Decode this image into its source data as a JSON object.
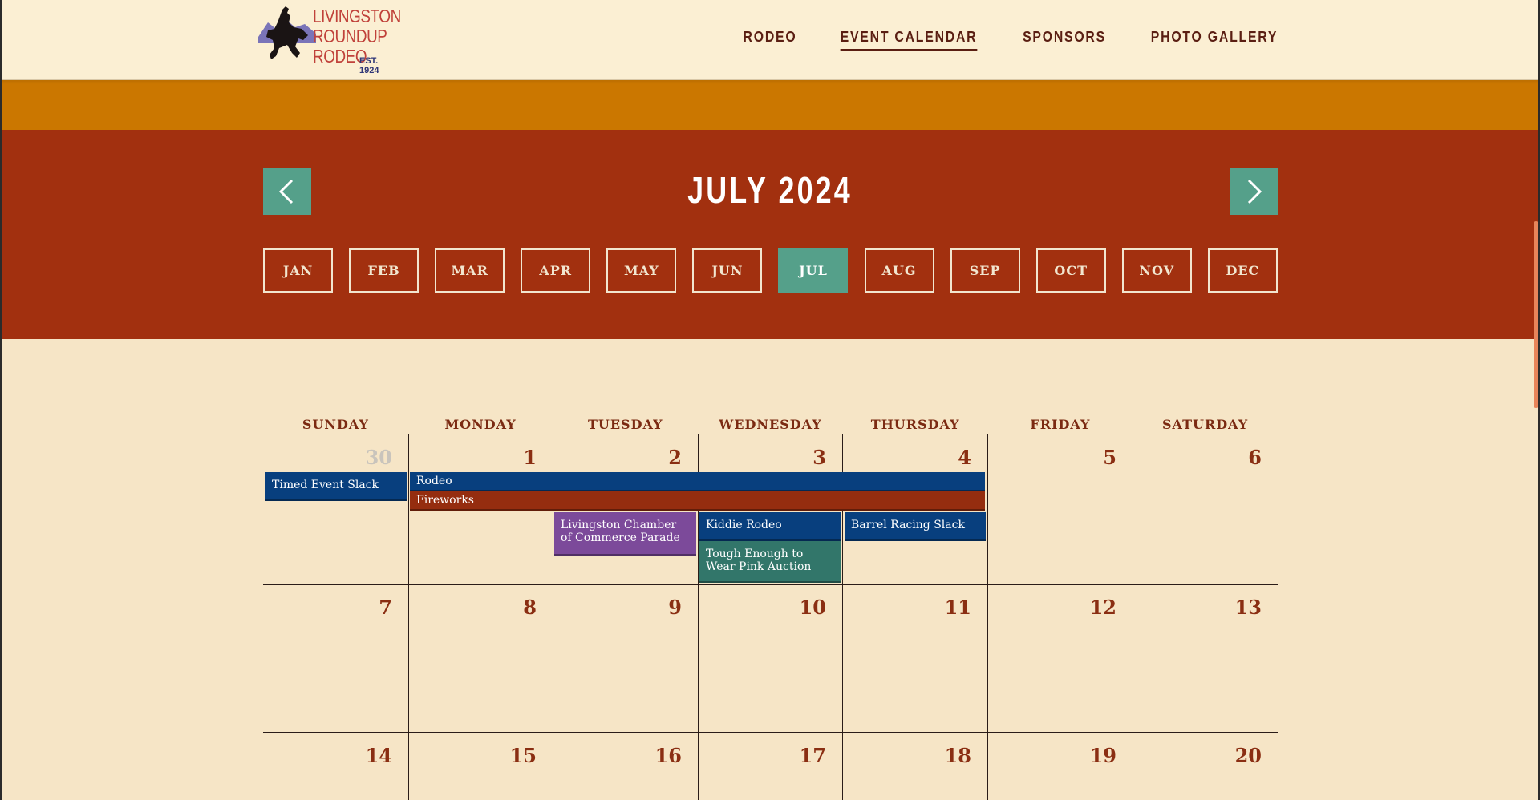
{
  "logo": {
    "lines": [
      "LIVINGSTON",
      "ROUNDUP",
      "RODEO"
    ],
    "est": "EST. 1924"
  },
  "nav": [
    {
      "label": "RODEO",
      "active": false
    },
    {
      "label": "EVENT CALENDAR",
      "active": true
    },
    {
      "label": "SPONSORS",
      "active": false
    },
    {
      "label": "PHOTO GALLERY",
      "active": false
    }
  ],
  "calendar_header": {
    "title": "JULY 2024",
    "months": [
      "JAN",
      "FEB",
      "MAR",
      "APR",
      "MAY",
      "JUN",
      "JUL",
      "AUG",
      "SEP",
      "OCT",
      "NOV",
      "DEC"
    ],
    "active_month": "JUL",
    "prev_icon": "chevron-left-icon",
    "next_icon": "chevron-right-icon"
  },
  "weekdays": [
    "SUNDAY",
    "MONDAY",
    "TUESDAY",
    "WEDNESDAY",
    "THURSDAY",
    "FRIDAY",
    "SATURDAY"
  ],
  "weeks": [
    [
      "30",
      "1",
      "2",
      "3",
      "4",
      "5",
      "6"
    ],
    [
      "7",
      "8",
      "9",
      "10",
      "11",
      "12",
      "13"
    ],
    [
      "14",
      "15",
      "16",
      "17",
      "18",
      "19",
      "20"
    ]
  ],
  "events": {
    "timed_event_slack": "Timed Event Slack",
    "rodeo": "Rodeo",
    "fireworks": "Fireworks",
    "parade": "Livingston Chamber of Commerce Parade",
    "kiddie_rodeo": "Kiddie Rodeo",
    "tough_enough": "Tough Enough to Wear Pink Auction",
    "barrel_racing": "Barrel Racing Slack"
  },
  "colors": {
    "gold_band": "#cb7700",
    "red_band": "#a2300f",
    "accent_teal": "#55a08a",
    "event_navy": "#083f7e",
    "event_red": "#952d0f",
    "event_purple": "#7c4a9a",
    "event_teal": "#32766a"
  }
}
